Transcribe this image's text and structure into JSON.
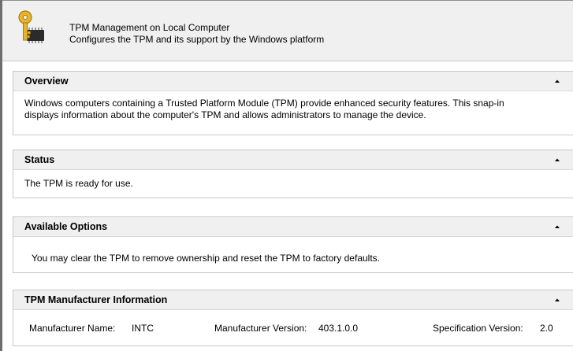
{
  "header": {
    "title": "TPM Management on Local Computer",
    "subtitle": "Configures the TPM and its support by the Windows platform"
  },
  "overview": {
    "title": "Overview",
    "text_line1": "Windows computers containing a Trusted Platform Module (TPM) provide enhanced security features. This snap-in",
    "text_line2": "displays information about the computer's TPM and allows administrators to manage the device."
  },
  "status": {
    "title": "Status",
    "text": "The TPM is ready for use."
  },
  "options": {
    "title": "Available Options",
    "text": "You may clear the TPM to remove ownership and reset the TPM to factory defaults."
  },
  "manufacturer": {
    "title": "TPM Manufacturer Information",
    "name_label": "Manufacturer Name:",
    "name_value": "INTC",
    "version_label": "Manufacturer Version:",
    "version_value": "403.1.0.0",
    "spec_label": "Specification Version:",
    "spec_value": "2.0"
  },
  "icons": {
    "app": "tpm-key-chip-icon",
    "collapse": "collapse-up-icon"
  }
}
